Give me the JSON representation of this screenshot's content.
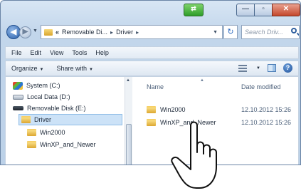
{
  "titlebar": {
    "buttons": {
      "green": "⇄",
      "minimize": "—",
      "maximize": "▫",
      "close": "✕"
    }
  },
  "address": {
    "prefix": "«",
    "crumbs": [
      "Removable Di...",
      "Driver"
    ],
    "search_placeholder": "Search Driv..."
  },
  "menu": [
    "File",
    "Edit",
    "View",
    "Tools",
    "Help"
  ],
  "toolbar": {
    "organize": "Organize",
    "share": "Share with"
  },
  "navpane": {
    "items": [
      {
        "label": "System (C:)",
        "icon": "system-drive-icon"
      },
      {
        "label": "Local Data (D:)",
        "icon": "drive-icon"
      },
      {
        "label": "Removable Disk (E:)",
        "icon": "usb-drive-icon"
      },
      {
        "label": "Driver",
        "icon": "folder-icon",
        "selected": true
      },
      {
        "label": "Win2000",
        "icon": "folder-icon"
      },
      {
        "label": "WinXP_and_Newer",
        "icon": "folder-icon"
      }
    ]
  },
  "filepane": {
    "columns": {
      "name": "Name",
      "date": "Date modified"
    },
    "rows": [
      {
        "name": "Win2000",
        "date": "12.10.2012 15:26"
      },
      {
        "name": "WinXP_and_Newer",
        "date": "12.10.2012 15:26"
      }
    ]
  },
  "colors": {
    "frame": "#c2d6eb",
    "selection": "#cce2f7",
    "folder": "#dca630",
    "close": "#c4472c"
  }
}
